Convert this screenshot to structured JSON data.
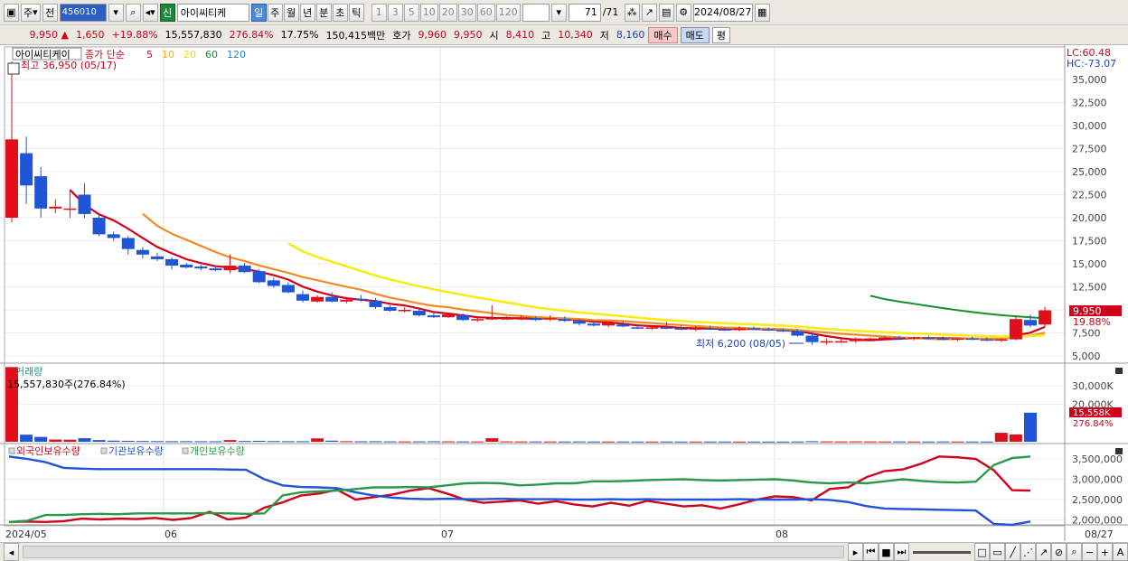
{
  "toolbar": {
    "type_label": "주",
    "prev_label": "전",
    "stock_code": "456010",
    "new_badge": "신",
    "stock_name": "아이씨티케",
    "periods": [
      {
        "label": "일",
        "sel": true
      },
      {
        "label": "주"
      },
      {
        "label": "월"
      },
      {
        "label": "년"
      },
      {
        "label": "분"
      },
      {
        "label": "초"
      },
      {
        "label": "틱"
      }
    ],
    "intervals": [
      "1",
      "3",
      "5",
      "10",
      "20",
      "30",
      "60",
      "120"
    ],
    "count_value": "71",
    "count_total": "/71",
    "date_value": "2024/08/27"
  },
  "quote": {
    "price": "9,950",
    "arrow": "▲",
    "change": "1,650",
    "change_pct": "+19.88%",
    "volume": "15,557,830",
    "volume_ratio": "276.84%",
    "turnover": "17.75%",
    "amount": "150,415백만",
    "bid_label": "호가",
    "bid1": "9,960",
    "bid2": "9,950",
    "open_label": "시",
    "open": "8,410",
    "high_label": "고",
    "high": "10,340",
    "low_label": "저",
    "low": "8,160",
    "buy_label": "매수",
    "sell_label": "매도",
    "avg_label": "평"
  },
  "price_panel": {
    "title": "아이씨티케이",
    "legend_label": "종가 단순",
    "ma_labels": [
      {
        "t": "5",
        "c": "#d0021b"
      },
      {
        "t": "10",
        "c": "#ffb000"
      },
      {
        "t": "20",
        "c": "#e8e000"
      },
      {
        "t": "60",
        "c": "#1a8f2d"
      },
      {
        "t": "120",
        "c": "#2a80c0"
      }
    ],
    "lc_label": "LC:60.48",
    "hc_label": "HC:-73.07",
    "high_annot": "최고 36,950 (05/17)",
    "low_annot": "최저 6,200 (08/05)",
    "current_label": "9,950",
    "current_pct": "19.88%",
    "y_ticks": [
      "35,000",
      "32,500",
      "30,000",
      "27,500",
      "25,000",
      "22,500",
      "20,000",
      "17,500",
      "15,000",
      "12,500",
      "10,000",
      "7,500",
      "5,000"
    ]
  },
  "volume_panel": {
    "title": "거래량",
    "info": "15,557,830주(276.84%)",
    "y_ticks": [
      "30,000K",
      "20,000K"
    ],
    "current_label": "15,558K",
    "current_pct": "276.84%"
  },
  "holdings_panel": {
    "legend": [
      {
        "t": "외국인보유수량",
        "c": "#d0021b"
      },
      {
        "t": "기관보유수량",
        "c": "#1f55d6"
      },
      {
        "t": "개인보유수량",
        "c": "#2a9a48"
      }
    ],
    "y_ticks": [
      "3,500,000",
      "3,000,000",
      "2,500,000",
      "2,000,000"
    ]
  },
  "x_axis": {
    "labels": [
      "2024/05",
      "06",
      "07",
      "08",
      "08/27"
    ]
  },
  "chart_data": {
    "type": "candlestick",
    "x_start": "2024/05",
    "x_end": "08/27",
    "ylim": [
      5000,
      37000
    ],
    "candles": [
      {
        "o": 20000,
        "h": 36950,
        "l": 19500,
        "c": 28500
      },
      {
        "o": 27000,
        "h": 28800,
        "l": 21500,
        "c": 23500
      },
      {
        "o": 24500,
        "h": 25500,
        "l": 20000,
        "c": 21000
      },
      {
        "o": 21000,
        "h": 22000,
        "l": 20500,
        "c": 21200
      },
      {
        "o": 21000,
        "h": 23000,
        "l": 20000,
        "c": 21000
      },
      {
        "o": 22500,
        "h": 23700,
        "l": 20000,
        "c": 20400
      },
      {
        "o": 20000,
        "h": 20400,
        "l": 18000,
        "c": 18200
      },
      {
        "o": 18200,
        "h": 18500,
        "l": 17500,
        "c": 17800
      },
      {
        "o": 17800,
        "h": 18000,
        "l": 16000,
        "c": 16600
      },
      {
        "o": 16500,
        "h": 16800,
        "l": 15600,
        "c": 16000
      },
      {
        "o": 15800,
        "h": 16200,
        "l": 15300,
        "c": 15500
      },
      {
        "o": 15500,
        "h": 15700,
        "l": 14400,
        "c": 14800
      },
      {
        "o": 14900,
        "h": 15100,
        "l": 14500,
        "c": 14600
      },
      {
        "o": 14700,
        "h": 14900,
        "l": 14300,
        "c": 14500
      },
      {
        "o": 14500,
        "h": 14700,
        "l": 14200,
        "c": 14300
      },
      {
        "o": 14300,
        "h": 16000,
        "l": 14000,
        "c": 14800
      },
      {
        "o": 14800,
        "h": 15100,
        "l": 14000,
        "c": 14100
      },
      {
        "o": 14200,
        "h": 14400,
        "l": 12900,
        "c": 13000
      },
      {
        "o": 13200,
        "h": 13500,
        "l": 12400,
        "c": 12600
      },
      {
        "o": 12700,
        "h": 13000,
        "l": 11800,
        "c": 11900
      },
      {
        "o": 11700,
        "h": 12100,
        "l": 10800,
        "c": 11000
      },
      {
        "o": 10900,
        "h": 11600,
        "l": 10800,
        "c": 11400
      },
      {
        "o": 11400,
        "h": 11900,
        "l": 10800,
        "c": 10900
      },
      {
        "o": 10900,
        "h": 11300,
        "l": 10700,
        "c": 11100
      },
      {
        "o": 11200,
        "h": 11600,
        "l": 10900,
        "c": 11100
      },
      {
        "o": 11000,
        "h": 11300,
        "l": 10100,
        "c": 10300
      },
      {
        "o": 10300,
        "h": 10500,
        "l": 9800,
        "c": 9900
      },
      {
        "o": 9900,
        "h": 10300,
        "l": 9700,
        "c": 10000
      },
      {
        "o": 9900,
        "h": 10100,
        "l": 9300,
        "c": 9400
      },
      {
        "o": 9400,
        "h": 9800,
        "l": 9100,
        "c": 9200
      },
      {
        "o": 9200,
        "h": 9600,
        "l": 9100,
        "c": 9500
      },
      {
        "o": 9400,
        "h": 9600,
        "l": 8800,
        "c": 8900
      },
      {
        "o": 8900,
        "h": 9300,
        "l": 8700,
        "c": 9000
      },
      {
        "o": 9000,
        "h": 10500,
        "l": 8900,
        "c": 9100
      },
      {
        "o": 9000,
        "h": 9300,
        "l": 8900,
        "c": 9100
      },
      {
        "o": 9100,
        "h": 9400,
        "l": 8900,
        "c": 9200
      },
      {
        "o": 9100,
        "h": 9300,
        "l": 8800,
        "c": 8900
      },
      {
        "o": 9000,
        "h": 9400,
        "l": 8800,
        "c": 9100
      },
      {
        "o": 9000,
        "h": 9300,
        "l": 8700,
        "c": 8800
      },
      {
        "o": 8800,
        "h": 9000,
        "l": 8300,
        "c": 8500
      },
      {
        "o": 8500,
        "h": 8800,
        "l": 8200,
        "c": 8300
      },
      {
        "o": 8300,
        "h": 8700,
        "l": 8100,
        "c": 8600
      },
      {
        "o": 8400,
        "h": 8800,
        "l": 8100,
        "c": 8200
      },
      {
        "o": 8100,
        "h": 8400,
        "l": 7900,
        "c": 8000
      },
      {
        "o": 8000,
        "h": 8300,
        "l": 7800,
        "c": 8100
      },
      {
        "o": 8100,
        "h": 8700,
        "l": 7900,
        "c": 8000
      },
      {
        "o": 8000,
        "h": 8300,
        "l": 7800,
        "c": 7900
      },
      {
        "o": 7900,
        "h": 8200,
        "l": 7700,
        "c": 8000
      },
      {
        "o": 8000,
        "h": 8300,
        "l": 7800,
        "c": 7900
      },
      {
        "o": 7900,
        "h": 8100,
        "l": 7700,
        "c": 7800
      },
      {
        "o": 7800,
        "h": 8200,
        "l": 7700,
        "c": 8000
      },
      {
        "o": 8000,
        "h": 8200,
        "l": 7800,
        "c": 7900
      },
      {
        "o": 7900,
        "h": 8100,
        "l": 7700,
        "c": 7800
      },
      {
        "o": 7800,
        "h": 8000,
        "l": 7600,
        "c": 7700
      },
      {
        "o": 7700,
        "h": 7900,
        "l": 7100,
        "c": 7200
      },
      {
        "o": 7200,
        "h": 7600,
        "l": 6200,
        "c": 6500
      },
      {
        "o": 6500,
        "h": 6900,
        "l": 6200,
        "c": 6600
      },
      {
        "o": 6600,
        "h": 6900,
        "l": 6400,
        "c": 6600
      },
      {
        "o": 6600,
        "h": 7000,
        "l": 6400,
        "c": 6900
      },
      {
        "o": 6800,
        "h": 7000,
        "l": 6600,
        "c": 6900
      },
      {
        "o": 6900,
        "h": 7100,
        "l": 6700,
        "c": 7000
      },
      {
        "o": 7000,
        "h": 7200,
        "l": 6800,
        "c": 6900
      },
      {
        "o": 6900,
        "h": 7100,
        "l": 6700,
        "c": 7000
      },
      {
        "o": 7000,
        "h": 7200,
        "l": 6800,
        "c": 6900
      },
      {
        "o": 6900,
        "h": 7100,
        "l": 6700,
        "c": 6800
      },
      {
        "o": 6800,
        "h": 7000,
        "l": 6600,
        "c": 6900
      },
      {
        "o": 6900,
        "h": 7100,
        "l": 6700,
        "c": 6800
      },
      {
        "o": 6800,
        "h": 7000,
        "l": 6600,
        "c": 6700
      },
      {
        "o": 6700,
        "h": 6900,
        "l": 6500,
        "c": 6800
      },
      {
        "o": 6800,
        "h": 9300,
        "l": 6700,
        "c": 9000
      },
      {
        "o": 8900,
        "h": 9500,
        "l": 8100,
        "c": 8300
      },
      {
        "o": 8410,
        "h": 10340,
        "l": 8160,
        "c": 9950
      }
    ],
    "volume_k": [
      40000,
      3800,
      2600,
      1200,
      1100,
      1900,
      900,
      600,
      500,
      400,
      350,
      300,
      300,
      280,
      260,
      900,
      400,
      500,
      350,
      300,
      280,
      1800,
      600,
      300,
      250,
      280,
      200,
      180,
      200,
      260,
      200,
      180,
      160,
      1900,
      200,
      180,
      160,
      150,
      140,
      160,
      140,
      130,
      150,
      120,
      120,
      140,
      120,
      110,
      120,
      110,
      100,
      110,
      100,
      100,
      150,
      300,
      200,
      180,
      220,
      180,
      150,
      160,
      140,
      130,
      160,
      140,
      130,
      130,
      4800,
      3900,
      15558
    ],
    "series": [
      {
        "name": "외국인보유수량",
        "values": [
          1950000,
          1960000,
          1950000,
          1970000,
          2030000,
          2010000,
          2030000,
          2020000,
          2050000,
          2000000,
          2050000,
          2200000,
          2010000,
          2060000,
          2300000,
          2430000,
          2600000,
          2650000,
          2740000,
          2500000,
          2560000,
          2620000,
          2720000,
          2780000,
          2650000,
          2500000,
          2420000,
          2450000,
          2480000,
          2400000,
          2460000,
          2380000,
          2330000,
          2420000,
          2350000,
          2470000,
          2400000,
          2330000,
          2360000,
          2280000,
          2380000,
          2500000,
          2580000,
          2560000,
          2480000,
          2760000,
          2800000,
          3050000,
          3200000,
          3240000,
          3380000,
          3560000,
          3540000,
          3500000,
          3220000,
          2730000,
          2720000
        ]
      },
      {
        "name": "기관보유수량",
        "values": [
          3560000,
          3500000,
          3420000,
          3280000,
          3260000,
          3250000,
          3250000,
          3250000,
          3250000,
          3250000,
          3250000,
          3250000,
          3240000,
          3230000,
          3000000,
          2850000,
          2810000,
          2800000,
          2780000,
          2680000,
          2600000,
          2550000,
          2520000,
          2510000,
          2520000,
          2510000,
          2510000,
          2520000,
          2510000,
          2510000,
          2510000,
          2500000,
          2500000,
          2510000,
          2500000,
          2510000,
          2500000,
          2500000,
          2500000,
          2500000,
          2510000,
          2500000,
          2500000,
          2500000,
          2510000,
          2490000,
          2440000,
          2340000,
          2280000,
          2270000,
          2260000,
          2250000,
          2240000,
          2230000,
          1900000,
          1880000,
          1960000
        ]
      },
      {
        "name": "개인보유수량",
        "values": [
          1950000,
          1980000,
          2120000,
          2120000,
          2140000,
          2150000,
          2140000,
          2160000,
          2160000,
          2160000,
          2160000,
          2170000,
          2160000,
          2150000,
          2160000,
          2600000,
          2680000,
          2700000,
          2720000,
          2760000,
          2800000,
          2800000,
          2810000,
          2800000,
          2850000,
          2900000,
          2910000,
          2900000,
          2850000,
          2870000,
          2900000,
          2900000,
          2950000,
          2950000,
          2960000,
          2980000,
          2990000,
          3000000,
          2980000,
          2970000,
          2980000,
          2990000,
          3000000,
          2970000,
          2920000,
          2900000,
          2920000,
          2900000,
          2950000,
          3000000,
          2960000,
          2930000,
          2920000,
          2940000,
          3350000,
          3520000,
          3560000
        ]
      }
    ]
  }
}
